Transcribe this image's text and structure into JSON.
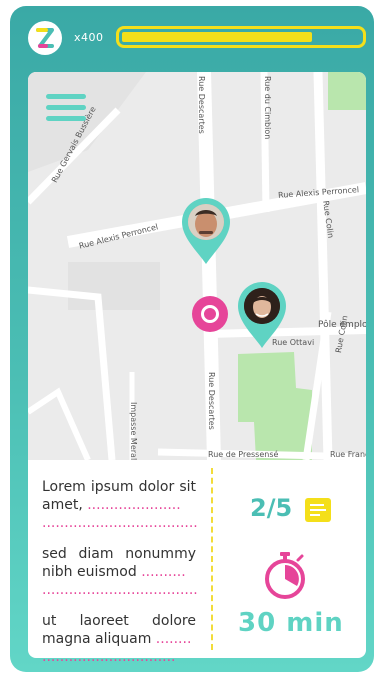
{
  "header": {
    "coins": "x400",
    "xp_fraction": 0.8,
    "logo_icon": "app-logo-icon"
  },
  "map": {
    "menu_icon": "hamburger-menu-icon",
    "streets": {
      "s1": "Rue Alexis Perroncel",
      "s2": "Rue Alexis Perroncel",
      "s3": "Rue Gervais Bussière",
      "s4": "Rue Descartes",
      "s5": "Rue du Cimbion",
      "s6": "Rue Colin",
      "s7": "Rue Colin",
      "s8": "Pôle emploi",
      "s9": "Rue Ottavi",
      "s10": "Impasse Meral",
      "s11": "Rue Descartes",
      "s12": "Rue de Pressensé",
      "s13": "Rue Franc"
    },
    "target_icon": "target-location-icon"
  },
  "panel": {
    "para1": "Lorem ipsum dolor sit amet,",
    "para2": "sed diam nonummy nibh euismod",
    "para3": "ut laoreet dolore magna aliquam",
    "progress": "2/5",
    "time": "30 min",
    "colors": {
      "accent": "#4bbeb4",
      "pink": "#e64599",
      "yellow": "#f4df1a"
    }
  }
}
